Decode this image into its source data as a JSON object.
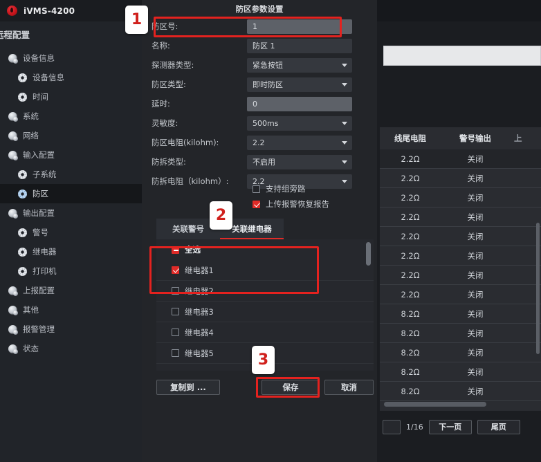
{
  "app": {
    "title": "iVMS-4200",
    "logo": "hikvision-logo-icon"
  },
  "sidebar": {
    "header": "远程配置",
    "items": [
      {
        "label": "设备信息",
        "level": 1,
        "icon": "group-icon",
        "active": false
      },
      {
        "label": "设备信息",
        "level": 2,
        "icon": "gear-icon",
        "active": false
      },
      {
        "label": "时间",
        "level": 2,
        "icon": "gear-icon",
        "active": false
      },
      {
        "label": "系统",
        "level": 1,
        "icon": "group-icon",
        "active": false
      },
      {
        "label": "网络",
        "level": 1,
        "icon": "group-icon",
        "active": false
      },
      {
        "label": "输入配置",
        "level": 1,
        "icon": "group-icon",
        "active": false
      },
      {
        "label": "子系统",
        "level": 2,
        "icon": "gear-icon",
        "active": false
      },
      {
        "label": "防区",
        "level": 2,
        "icon": "gear-icon-blue",
        "active": true
      },
      {
        "label": "输出配置",
        "level": 1,
        "icon": "group-icon",
        "active": false
      },
      {
        "label": "警号",
        "level": 2,
        "icon": "gear-icon",
        "active": false
      },
      {
        "label": "继电器",
        "level": 2,
        "icon": "gear-icon",
        "active": false
      },
      {
        "label": "打印机",
        "level": 2,
        "icon": "gear-icon",
        "active": false
      },
      {
        "label": "上报配置",
        "level": 1,
        "icon": "group-icon",
        "active": false
      },
      {
        "label": "其他",
        "level": 1,
        "icon": "group-icon",
        "active": false
      },
      {
        "label": "报警管理",
        "level": 1,
        "icon": "group-icon",
        "active": false
      },
      {
        "label": "状态",
        "level": 1,
        "icon": "group-icon",
        "active": false
      }
    ]
  },
  "dialog": {
    "title": "防区参数设置",
    "fields": [
      {
        "label": "防区号:",
        "value": "1",
        "type": "input-readonly"
      },
      {
        "label": "名称:",
        "value": "防区 1",
        "type": "input"
      },
      {
        "label": "探测器类型:",
        "value": "紧急按钮",
        "type": "select"
      },
      {
        "label": "防区类型:",
        "value": "即时防区",
        "type": "select"
      },
      {
        "label": "延时:",
        "value": "0",
        "type": "input-readonly"
      },
      {
        "label": "灵敏度:",
        "value": "500ms",
        "type": "select"
      },
      {
        "label": "防区电阻(kilohm):",
        "value": "2.2",
        "type": "select"
      },
      {
        "label": "防拆类型:",
        "value": "不启用",
        "type": "select"
      },
      {
        "label": "防拆电阻（kilohm）:",
        "value": "2.2",
        "type": "select"
      }
    ],
    "checkboxes": [
      {
        "label": "支持组旁路",
        "checked": false
      },
      {
        "label": "上传报警恢复报告",
        "checked": true
      }
    ],
    "tabs": [
      {
        "label": "关联警号",
        "active": false
      },
      {
        "label": "关联继电器",
        "active": true
      }
    ],
    "list": [
      {
        "label": "全选",
        "state": "indeterminate"
      },
      {
        "label": "继电器1",
        "state": "checked"
      },
      {
        "label": "继电器2",
        "state": "unchecked"
      },
      {
        "label": "继电器3",
        "state": "unchecked"
      },
      {
        "label": "继电器4",
        "state": "unchecked"
      },
      {
        "label": "继电器5",
        "state": "unchecked"
      }
    ],
    "buttons": {
      "copy_to": "复制到 ...",
      "save": "保存",
      "cancel": "取消"
    }
  },
  "table": {
    "headers": [
      "线尾电阻",
      "警号输出",
      "上"
    ],
    "rows": [
      {
        "resistance": "2.2Ω",
        "siren_output": "关闭",
        "selected": true
      },
      {
        "resistance": "2.2Ω",
        "siren_output": "关闭",
        "selected": false
      },
      {
        "resistance": "2.2Ω",
        "siren_output": "关闭",
        "selected": false
      },
      {
        "resistance": "2.2Ω",
        "siren_output": "关闭",
        "selected": false
      },
      {
        "resistance": "2.2Ω",
        "siren_output": "关闭",
        "selected": false
      },
      {
        "resistance": "2.2Ω",
        "siren_output": "关闭",
        "selected": false
      },
      {
        "resistance": "2.2Ω",
        "siren_output": "关闭",
        "selected": false
      },
      {
        "resistance": "2.2Ω",
        "siren_output": "关闭",
        "selected": false
      },
      {
        "resistance": "8.2Ω",
        "siren_output": "关闭",
        "selected": false
      },
      {
        "resistance": "8.2Ω",
        "siren_output": "关闭",
        "selected": false
      },
      {
        "resistance": "8.2Ω",
        "siren_output": "关闭",
        "selected": false
      },
      {
        "resistance": "8.2Ω",
        "siren_output": "关闭",
        "selected": false
      },
      {
        "resistance": "8.2Ω",
        "siren_output": "关闭",
        "selected": false
      }
    ],
    "pagination": {
      "page_info": "1/16",
      "next": "下一页",
      "last": "尾页"
    }
  },
  "annotations": {
    "colors": {
      "highlight": "#e4221f",
      "accent": "#e02b28"
    },
    "steps": [
      {
        "number": "1"
      },
      {
        "number": "2"
      },
      {
        "number": "3"
      }
    ]
  }
}
